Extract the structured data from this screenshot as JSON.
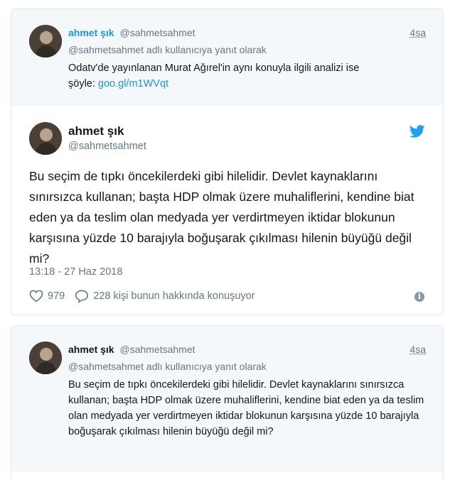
{
  "parent_tweet_1": {
    "author_name": "ahmet şık",
    "author_handle": "@sahmetsahmet",
    "time": "4sa",
    "reply_context": "@sahmetsahmet adlı kullanıcıya yanıt olarak",
    "text_line1": "Odatv'de yayınlanan Murat Ağırel'in aynı konuyla ilgili analizi ise",
    "text_prefix": "şöyle: ",
    "link": "goo.gl/m1WVqt"
  },
  "main_tweet": {
    "author_name": "ahmet şık",
    "author_handle": "@sahmetsahmet",
    "text": "Bu seçim de tıpkı öncekilerdeki gibi hilelidir. Devlet kaynaklarını sınırsızca kullanan; başta HDP olmak üzere muhaliflerini, kendine biat eden ya da teslim olan medyada yer verdirtmeyen iktidar blokunun karşısına yüzde 10 barajıyla boğuşarak çıkılması hilenin büyüğü değil mi?",
    "date": "13:18 - 27 Haz 2018",
    "like_count": "979",
    "reply_summary": "228 kişi bunun hakkında konuşuyor"
  },
  "parent_tweet_2": {
    "author_name": "ahmet şık",
    "author_handle": "@sahmetsahmet",
    "time": "4sa",
    "reply_context": "@sahmetsahmet adlı kullanıcıya yanıt olarak",
    "text": "Bu seçim de tıpkı öncekilerdeki gibi hilelidir. Devlet kaynaklarını sınırsızca kullanan; başta HDP olmak üzere muhaliflerini, kendine biat eden ya da teslim olan medyada yer verdirtmeyen iktidar blokunun karşısına yüzde 10 barajıyla boğuşarak çıkılması hilenin büyüğü değil mi?"
  },
  "icons": {
    "brand": "twitter-bird-icon",
    "like": "heart-icon",
    "reply": "speech-bubble-icon",
    "info": "info-icon"
  },
  "colors": {
    "link": "#1b95e0",
    "muted": "#657786",
    "text": "#14171a",
    "border": "#e1e8ed",
    "panel": "#f5f8fa",
    "bird": "#1da1f2"
  }
}
